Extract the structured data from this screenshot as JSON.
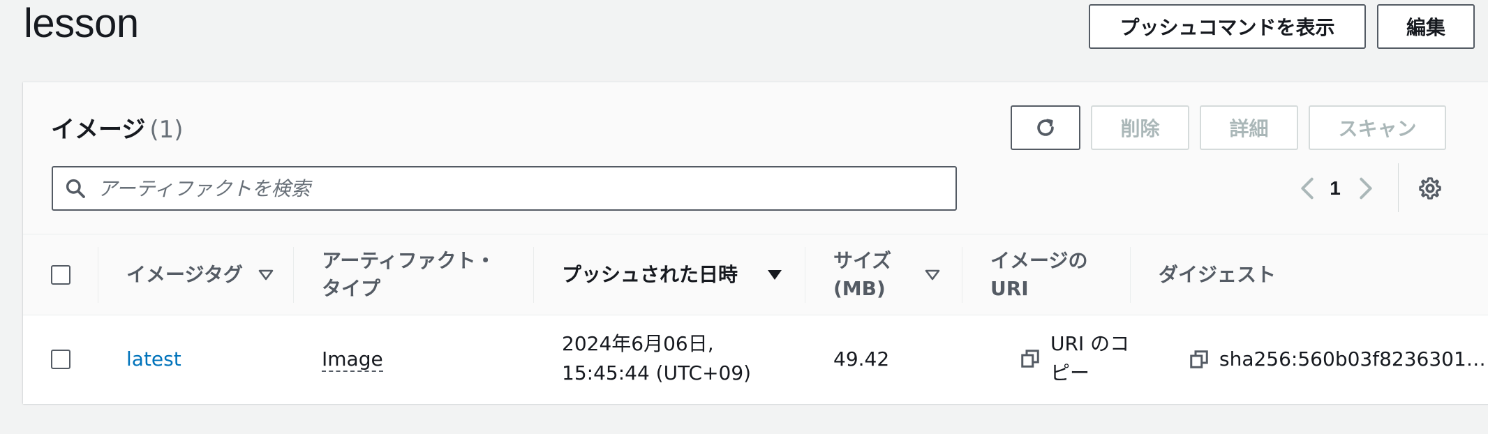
{
  "header": {
    "title": "lesson",
    "push_commands_label": "プッシュコマンドを表示",
    "edit_label": "編集"
  },
  "images_panel": {
    "title": "イメージ",
    "count": "(1)",
    "delete_label": "削除",
    "details_label": "詳細",
    "scan_label": "スキャン",
    "search_placeholder": "アーティファクトを検索",
    "page_number": "1"
  },
  "table": {
    "columns": {
      "image_tag": "イメージタグ",
      "artifact_type_line1": "アーティファクト・",
      "artifact_type_line2": "タイプ",
      "pushed_at": "プッシュされた日時",
      "size_line1": "サイズ",
      "size_line2": "(MB)",
      "uri_line1": "イメージの",
      "uri_line2": "URI",
      "digest": "ダイジェスト"
    },
    "rows": [
      {
        "image_tag": "latest",
        "artifact_type": "Image",
        "pushed_at_line1": "2024年6月06日,",
        "pushed_at_line2": "15:45:44 (UTC+09)",
        "size": "49.42",
        "uri_copy_line1": "URI のコ",
        "uri_copy_line2": "ピー",
        "digest": "sha256:560b03f8236301…"
      }
    ]
  },
  "colors": {
    "background": "#f2f3f3",
    "link": "#0073bb",
    "border": "#545b64",
    "disabled": "#aab7b8"
  },
  "icons": {
    "refresh": "refresh-icon",
    "search": "search-icon",
    "prev": "chevron-left-icon",
    "next": "chevron-right-icon",
    "settings": "gear-icon",
    "copy": "copy-icon",
    "sort": "sort-triangle-icon"
  }
}
